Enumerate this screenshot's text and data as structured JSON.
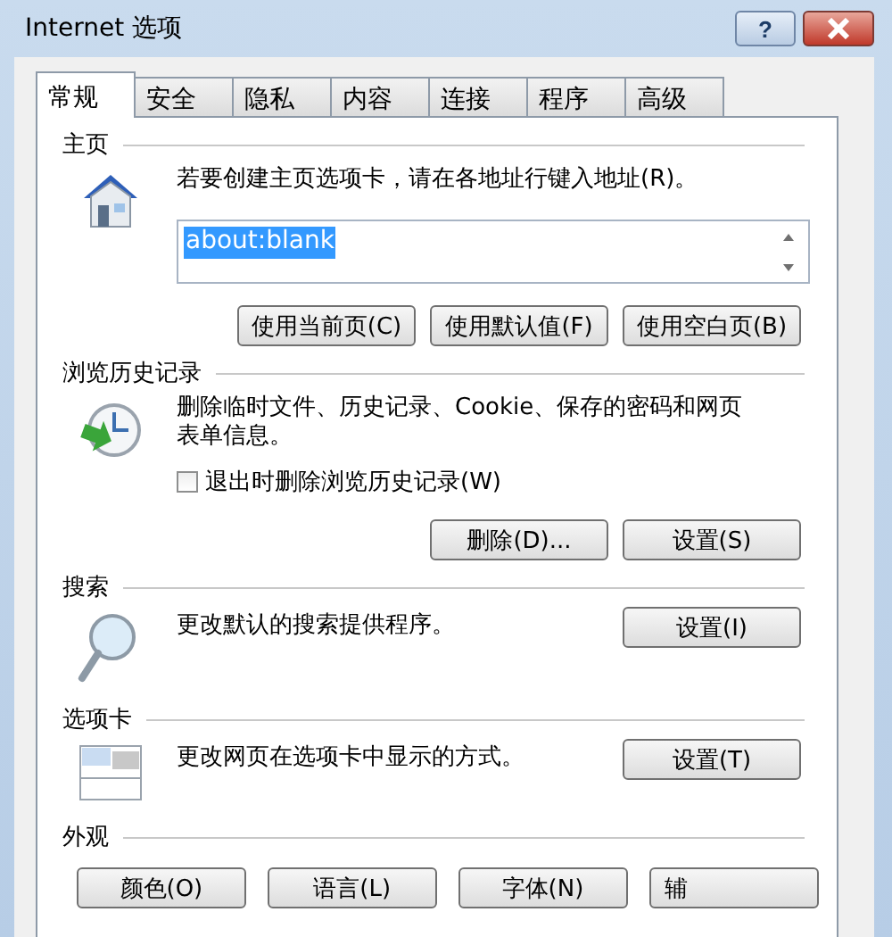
{
  "window": {
    "title": "Internet 选项",
    "help": "?"
  },
  "tabs": [
    {
      "label": "常规",
      "selected": true
    },
    {
      "label": "安全",
      "selected": false
    },
    {
      "label": "隐私",
      "selected": false
    },
    {
      "label": "内容",
      "selected": false
    },
    {
      "label": "连接",
      "selected": false
    },
    {
      "label": "程序",
      "selected": false
    },
    {
      "label": "高级",
      "selected": false
    }
  ],
  "sections": [
    {
      "kind": "home",
      "title": "主页",
      "description": "若要创建主页选项卡，请在各地址行键入地址(R)。",
      "field": {
        "value": "about:blank",
        "selected": true
      },
      "buttons": [
        "使用当前页(C)",
        "使用默认值(F)",
        "使用空白页(B)"
      ]
    },
    {
      "kind": "history",
      "title": "浏览历史记录",
      "description": "删除临时文件、历史记录、Cookie、保存的密码和网页表单信息。",
      "checkbox": {
        "label": "退出时删除浏览历史记录(W)",
        "checked": false
      },
      "buttons": [
        "删除(D)...",
        "设置(S)"
      ]
    },
    {
      "kind": "search",
      "title": "搜索",
      "description": "更改默认的搜索提供程序。",
      "buttons": [
        "设置(I)"
      ]
    },
    {
      "kind": "tabs",
      "title": "选项卡",
      "description": "更改网页在选项卡中显示的方式。",
      "buttons": [
        "设置(T)"
      ]
    },
    {
      "kind": "appearance",
      "title": "外观",
      "buttons": [
        "颜色(O)",
        "语言(L)",
        "字体(N)",
        "辅"
      ]
    }
  ]
}
